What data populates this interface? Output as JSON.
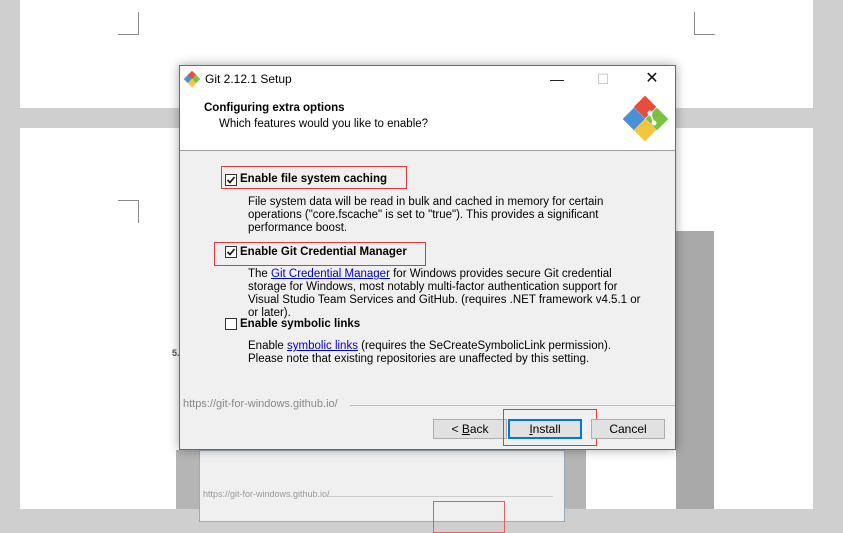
{
  "window": {
    "title": "Git 2.12.1 Setup"
  },
  "header": {
    "title": "Configuring extra options",
    "subtitle": "Which features would you like to enable?"
  },
  "options": [
    {
      "label": "Enable file system caching",
      "checked": true,
      "desc": "File system data will be read in bulk and cached in memory for certain operations (\"core.fscache\" is set to \"true\"). This provides a significant performance boost."
    },
    {
      "label": "Enable Git Credential Manager",
      "checked": true,
      "desc_before": "The ",
      "desc_link": "Git Credential Manager",
      "desc_after": " for Windows provides secure Git credential storage for Windows, most notably multi-factor authentication support for Visual Studio Team Services and GitHub. (requires .NET framework v4.5.1 or or later)."
    },
    {
      "label": "Enable symbolic links",
      "checked": false,
      "desc_before": "Enable ",
      "desc_link": "symbolic links",
      "desc_after": " (requires the SeCreateSymbolicLink permission). Please note that existing repositories are unaffected by this setting."
    }
  ],
  "footer": {
    "url": "https://git-for-windows.github.io/",
    "back_mnemonic": "B",
    "back_rest": "ack",
    "back_prefix": "< ",
    "install_mnemonic": "I",
    "install_rest": "nstall",
    "cancel_label": "Cancel"
  },
  "background": {
    "ghost_url": "https://git-for-windows.github.io/",
    "margin_marker": "5."
  },
  "colors": {
    "highlight": "#e23a3a",
    "accent": "#0078d7",
    "link": "#0000cc"
  }
}
